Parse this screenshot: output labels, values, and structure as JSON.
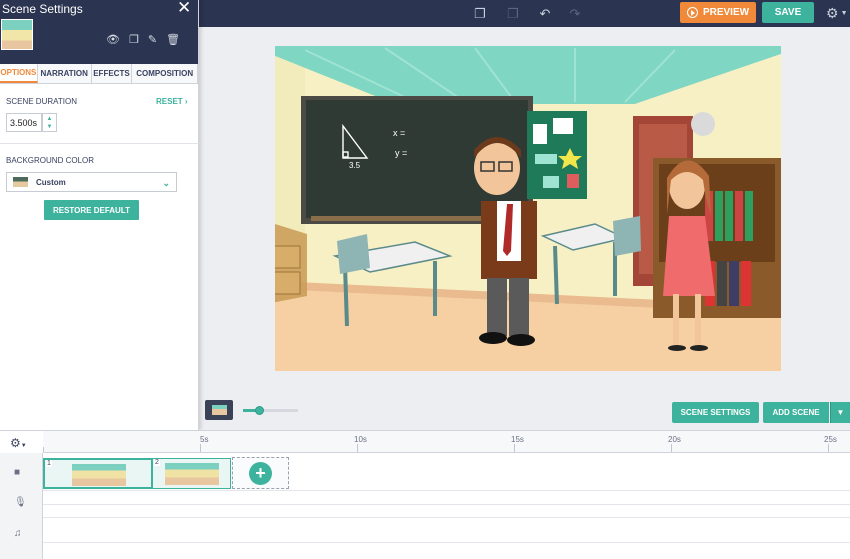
{
  "toolbar": {
    "preview_label": "PREVIEW",
    "save_label": "SAVE",
    "icons": [
      "copy-icon",
      "paste-icon",
      "undo-icon",
      "redo-icon",
      "gear-icon"
    ]
  },
  "panel": {
    "title": "Scene Settings",
    "close_symbol": "✕",
    "tabs": [
      {
        "label": "OPTIONS"
      },
      {
        "label": "NARRATION"
      },
      {
        "label": "EFFECTS"
      },
      {
        "label": "COMPOSITION"
      }
    ],
    "active_tab": "OPTIONS",
    "scene_duration_label": "SCENE DURATION",
    "reset_label": "RESET",
    "duration_value": "3.500s",
    "background_color_label": "BACKGROUND COLOR",
    "background_value": "Custom",
    "restore_label": "RESTORE DEFAULT"
  },
  "stage": {
    "board_text": [
      "3.5",
      "x =",
      "y ="
    ]
  },
  "controls": {
    "scene_settings_label": "SCENE SETTINGS",
    "add_scene_label": "ADD SCENE"
  },
  "timeline": {
    "ticks": [
      "5s",
      "10s",
      "15s",
      "20s",
      "25s"
    ],
    "clips": [
      {
        "number": "1",
        "selected": true
      },
      {
        "number": "2",
        "selected": false
      }
    ],
    "add_symbol": "+"
  },
  "colors": {
    "accent": "#3db39e",
    "preview": "#f08a3a",
    "topbar": "#2b3450"
  }
}
